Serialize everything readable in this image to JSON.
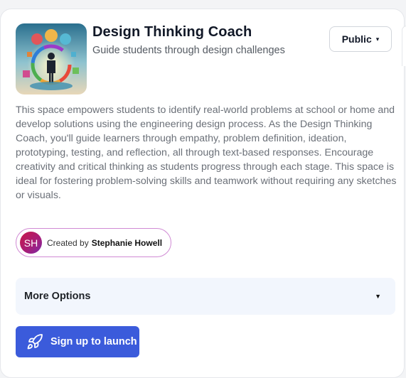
{
  "space": {
    "title": "Design Thinking Coach",
    "subtitle": "Guide students through design challenges",
    "visibility": "Public",
    "thumbnail_icon": "design-thinking-illustration",
    "description": "This space empowers students to identify real-world problems at school or home and develop solutions using the engineering design process. As the Design Thinking Coach, you'll guide learners through empathy, problem definition, ideation, prototyping, testing, and reflection, all through text-based responses. Encourage creativity and critical thinking as students progress through each stage. This space is ideal for fostering problem-solving skills and teamwork without requiring any sketches or visuals."
  },
  "creator": {
    "initials": "SH",
    "created_by_label": "Created by",
    "name": "Stephanie Howell"
  },
  "options": {
    "more_options_label": "More Options"
  },
  "actions": {
    "launch_label": "Sign up to launch",
    "launch_icon": "rocket-icon"
  },
  "colors": {
    "primary": "#3b5bdb",
    "options_bg": "#f2f6fd",
    "creator_border": "#d08ad4"
  }
}
